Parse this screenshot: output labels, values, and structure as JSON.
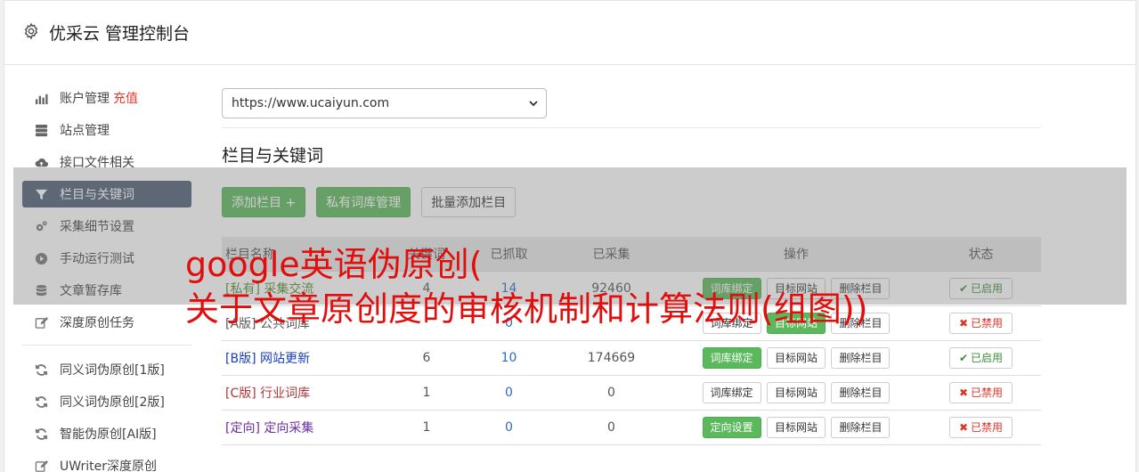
{
  "header": {
    "title": "优采云 管理控制台",
    "icon": "gear-icon"
  },
  "sidebar": {
    "items": [
      {
        "label": "账户管理",
        "extra": "充值",
        "icon": "bar-chart-icon"
      },
      {
        "label": "站点管理",
        "icon": "server-icon"
      },
      {
        "label": "接口文件相关",
        "icon": "cloud-upload-icon"
      },
      {
        "label": "栏目与关键词",
        "icon": "filter-icon",
        "active": true
      },
      {
        "label": "采集细节设置",
        "icon": "gears-icon"
      },
      {
        "label": "手动运行测试",
        "icon": "play-circle-icon"
      },
      {
        "label": "文章暂存库",
        "icon": "database-icon"
      },
      {
        "label": "深度原创任务",
        "icon": "edit-icon"
      }
    ],
    "items2": [
      {
        "label": "同义词伪原创[1版]",
        "icon": "refresh-icon"
      },
      {
        "label": "同义词伪原创[2版]",
        "icon": "refresh-icon"
      },
      {
        "label": "智能伪原创[AI版]",
        "icon": "refresh-icon"
      },
      {
        "label": "UWriter深度原创",
        "icon": "edit-icon"
      }
    ]
  },
  "main": {
    "site_select": "https://www.ucaiyun.com",
    "section_title": "栏目与关键词",
    "buttons": {
      "add": "添加栏目 +",
      "lib": "私有词库管理",
      "batch": "批量添加栏目"
    },
    "table": {
      "headers": [
        "栏目名称",
        "关键词",
        "已抓取",
        "已采集",
        "操作",
        "状态"
      ],
      "rows": [
        {
          "tag": "[私有]",
          "name": "采集交流",
          "kw": "4",
          "fetched": "14",
          "collected": "92460",
          "bind": "词库绑定",
          "bind_green": true,
          "target": "目标网站",
          "del": "删除栏目",
          "status": "已启用",
          "on": true
        },
        {
          "tag": "[A版]",
          "name": "公共词库",
          "kw": "",
          "fetched": "0",
          "collected": "",
          "bind": "词库绑定",
          "bind_green": false,
          "target": "目标网站",
          "del": "删除栏目",
          "status": "已禁用",
          "on": false
        },
        {
          "tag": "[B版]",
          "name": "网站更新",
          "kw": "6",
          "fetched": "10",
          "collected": "174669",
          "bind": "词库绑定",
          "bind_green": true,
          "target": "目标网站",
          "del": "删除栏目",
          "status": "已启用",
          "on": true
        },
        {
          "tag": "[C版]",
          "name": "行业词库",
          "kw": "1",
          "fetched": "0",
          "collected": "0",
          "bind": "词库绑定",
          "bind_green": false,
          "target": "目标网站",
          "del": "删除栏目",
          "status": "已禁用",
          "on": false
        },
        {
          "tag": "[定向]",
          "name": "定向采集",
          "kw": "1",
          "fetched": "0",
          "collected": "0",
          "bind": "定向设置",
          "bind_green": true,
          "target": "目标网站",
          "del": "删除栏目",
          "status": "已禁用",
          "on": false
        }
      ]
    }
  },
  "watermark": {
    "line1": "google英语伪原创(",
    "line2": "关于文章原创度的审核机制和计算法则(组图))"
  },
  "colors": {
    "active_nav": "#4d5d75",
    "green": "#5cb85c",
    "red_text": "#e20d0d"
  }
}
